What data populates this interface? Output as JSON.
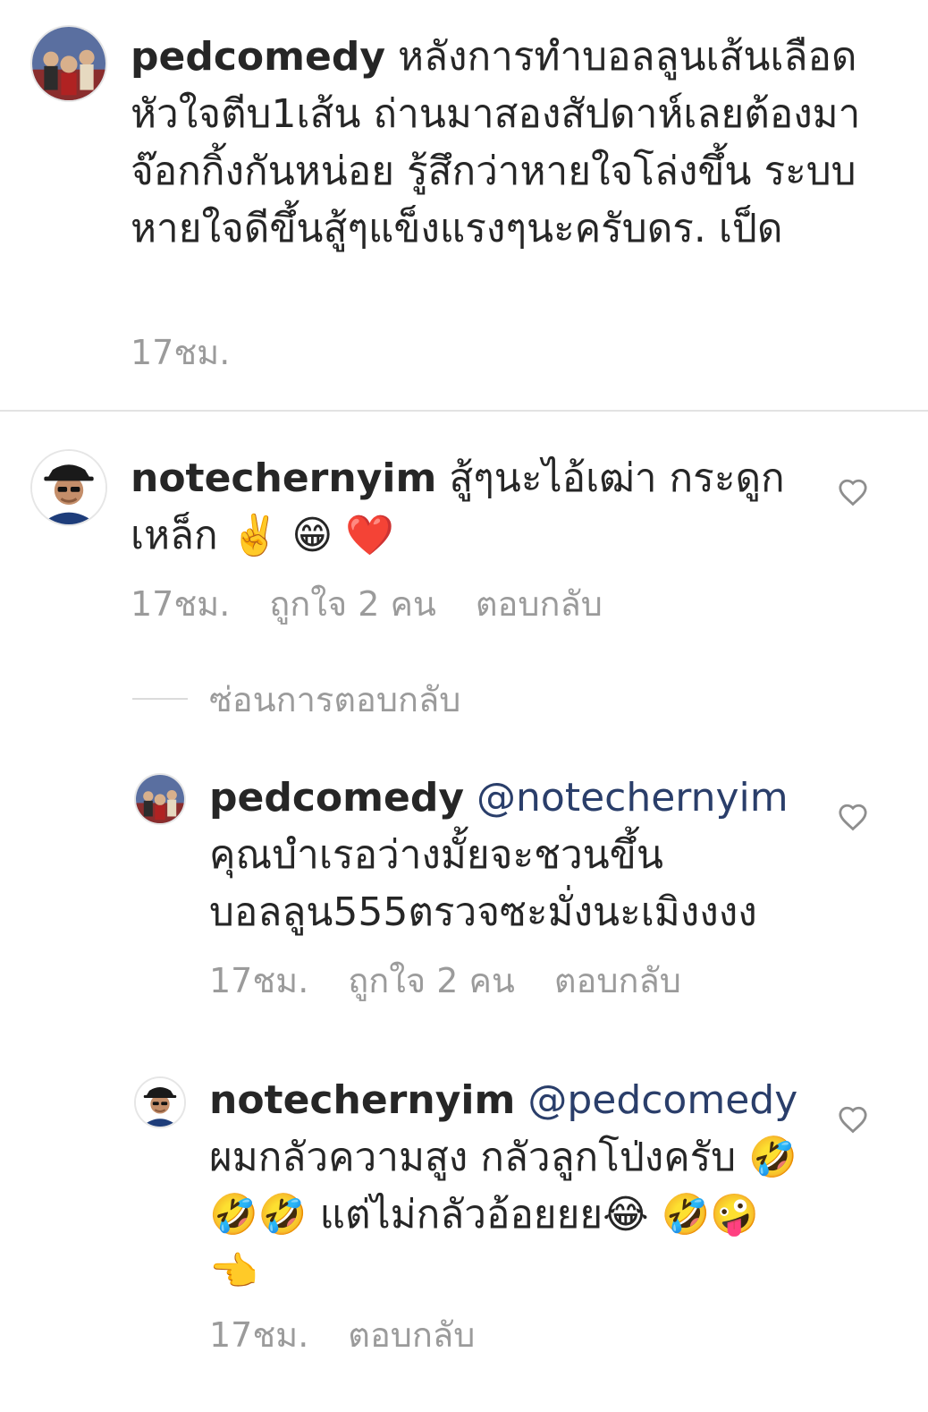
{
  "caption": {
    "username": "pedcomedy",
    "text": "หลังการทำบอลลูนเส้นเลือดหัวใจตีบ1เส้น ถ่านมาสองสัปดาห์เลยต้องมาจ๊อกกิ้งกันหน่อย รู้สึกว่าหายใจโล่งขึ้น ระบบหายใจดีขึ้นสู้ๆแข็งแรงๆนะครับดร. เป็ด",
    "time": "17ชม."
  },
  "comments": [
    {
      "username": "notechernyim",
      "text": "สู้ๆนะไอ้เฒ่า กระดูกเหล็ก",
      "emoji": "✌️ 😁 ❤️",
      "time": "17ชม.",
      "likes": "ถูกใจ 2 คน",
      "reply": "ตอบกลับ",
      "like_icon": "heart-outline-icon"
    }
  ],
  "hide_replies_label": "ซ่อนการตอบกลับ",
  "replies": [
    {
      "username": "pedcomedy",
      "mention": "@notechernyim",
      "text": "คุณบำเรอว่างมั้ยจะชวนขึ้นบอลลูน555ตรวจซะมั่งนะเมิงงงง",
      "time": "17ชม.",
      "likes": "ถูกใจ 2 คน",
      "reply": "ตอบกลับ"
    },
    {
      "username": "notechernyim",
      "mention": "@pedcomedy",
      "text": "ผมกลัวความสูง กลัวลูกโป่งครับ",
      "emoji_line1": "🤣🤣🤣",
      "text2": "แต่ไม่กลัวอ้อยยย",
      "emoji_line1_end": "😂",
      "emoji_line2": "🤣🤪👈",
      "time": "17ชม.",
      "reply": "ตอบกลับ"
    }
  ],
  "colors": {
    "text": "#262626",
    "meta": "#9b9b9b",
    "mention": "#2a3e6a",
    "divider": "#e3e3e3"
  }
}
